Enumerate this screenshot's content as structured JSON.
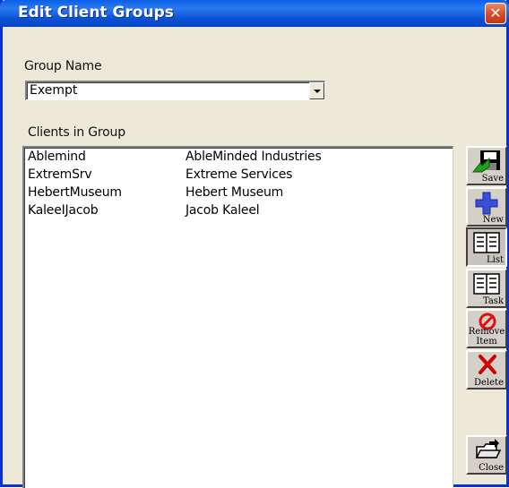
{
  "window": {
    "title": "Edit Client Groups",
    "close_icon": "close-icon"
  },
  "group": {
    "label": "Group Name",
    "value": "Exempt"
  },
  "clients": {
    "label": "Clients in Group",
    "rows": [
      {
        "code": "Ablemind",
        "name": "AbleMinded Industries"
      },
      {
        "code": "ExtremSrv",
        "name": "Extreme Services"
      },
      {
        "code": "HebertMuseum",
        "name": "Hebert Museum"
      },
      {
        "code": "KaleeIJacob",
        "name": "Jacob Kaleel"
      }
    ]
  },
  "toolbar": {
    "save": {
      "label": "Save",
      "icon": "floppy-disk-icon"
    },
    "new": {
      "label": "New",
      "icon": "plus-icon"
    },
    "list": {
      "label": "List",
      "icon": "list-view-icon"
    },
    "task": {
      "label": "Task",
      "icon": "task-view-icon"
    },
    "remove": {
      "label_line1": "Remove",
      "label_line2": "Item",
      "icon": "no-entry-icon"
    },
    "delete": {
      "label": "Delete",
      "icon": "red-x-icon"
    },
    "close": {
      "label": "Close",
      "icon": "open-folder-icon"
    }
  },
  "colors": {
    "titlebar": "#0a52d6",
    "window_bg": "#ece9d8",
    "close_button": "#d74a25"
  }
}
